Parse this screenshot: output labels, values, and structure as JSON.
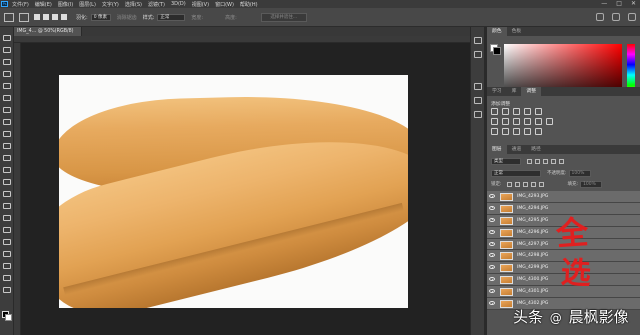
{
  "app": {
    "logo_text": "Ps",
    "menu": [
      "文件(F)",
      "编辑(E)",
      "图像(I)",
      "图层(L)",
      "文字(Y)",
      "选择(S)",
      "滤镜(T)",
      "3D(D)",
      "视图(V)",
      "窗口(W)",
      "帮助(H)"
    ],
    "window_controls": [
      "—",
      "□",
      "✕"
    ]
  },
  "options_bar": {
    "feather_label": "羽化:",
    "feather_value": "0 像素",
    "antialias_label": "消除锯齿",
    "style_label": "样式:",
    "style_value": "正常",
    "width_label": "宽度:",
    "height_label": "高度:",
    "select_subject_button": "选择并遮住..."
  },
  "document": {
    "tab_title": "IMG_4... @ 50%(RGB/8)",
    "photo_subject": "orange suede fabric roll"
  },
  "panels": {
    "color_tabs": [
      "颜色",
      "色板"
    ],
    "adjust_tabs": [
      "学习",
      "库",
      "调整"
    ],
    "adjust_title": "添加调整",
    "layers_tabs": [
      "图层",
      "通道",
      "路径"
    ],
    "filter_type": "类型",
    "blend_mode": "正常",
    "opacity_label": "不透明度:",
    "opacity_value": "100%",
    "lock_label": "锁定:",
    "fill_label": "填充:",
    "fill_value": "100%"
  },
  "layers": [
    "IMG_4293.JPG",
    "IMG_4294.JPG",
    "IMG_4295.JPG",
    "IMG_4296.JPG",
    "IMG_4297.JPG",
    "IMG_4298.JPG",
    "IMG_4299.JPG",
    "IMG_4300.JPG",
    "IMG_4301.JPG",
    "IMG_4302.JPG"
  ],
  "annotation": {
    "line1": "全",
    "line2": "选"
  },
  "watermark": {
    "platform": "头条",
    "separator": "@",
    "author": "晨枫影像"
  },
  "colors": {
    "ps_blue": "#31a8ff",
    "annotation_red": "#e02020",
    "fabric_orange": "#e2a253"
  }
}
